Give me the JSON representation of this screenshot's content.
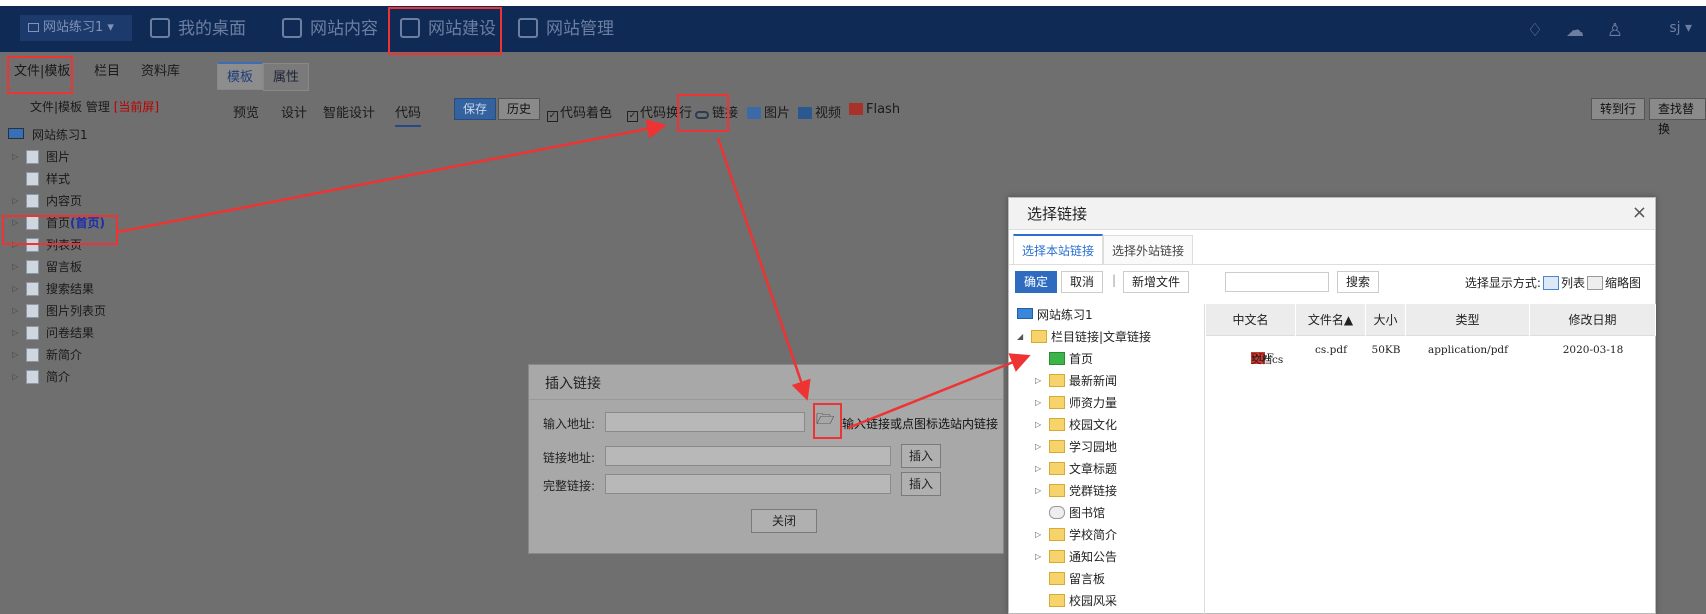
{
  "topbar": {
    "site_selector": "网站练习1",
    "nav": [
      {
        "label": "我的桌面",
        "icon": "grid-icon"
      },
      {
        "label": "网站内容",
        "icon": "edit-icon"
      },
      {
        "label": "网站建设",
        "icon": "build-icon"
      },
      {
        "label": "网站管理",
        "icon": "manage-icon"
      }
    ],
    "user": "sj ▾",
    "right_icons": [
      "bell-icon",
      "cloud-icon",
      "shirt-icon"
    ]
  },
  "left": {
    "tabs": [
      "文件|模板",
      "栏目",
      "资料库"
    ],
    "subtitle": "文件|模板 管理",
    "subtitle_tag": "[当前屏]",
    "tree_root": "网站练习1",
    "tree": [
      {
        "label": "图片",
        "selected": false
      },
      {
        "label": "样式",
        "selected": false
      },
      {
        "label": "内容页",
        "selected": false
      },
      {
        "label": "首页",
        "extra": "(首页)",
        "selected": true
      },
      {
        "label": "列表页",
        "selected": false
      },
      {
        "label": "留言板",
        "selected": false
      },
      {
        "label": "搜索结果",
        "selected": false
      },
      {
        "label": "图片列表页",
        "selected": false
      },
      {
        "label": "问卷结果",
        "selected": false
      },
      {
        "label": "新简介",
        "selected": false
      },
      {
        "label": "简介",
        "selected": false
      }
    ]
  },
  "editor": {
    "tabs": [
      "模板",
      "属性"
    ],
    "modes": [
      "预览",
      "设计",
      "智能设计",
      "代码"
    ],
    "save": "保存",
    "history": "历史",
    "opt_color": "代码着色",
    "opt_wrap": "代码换行",
    "link": "链接",
    "image": "图片",
    "video": "视频",
    "flash": "Flash",
    "goto_line": "转到行",
    "find_replace": "查找替换"
  },
  "insert_link": {
    "title": "插入链接",
    "input_label": "输入地址:",
    "hint": "输入链接或点图标选站内链接",
    "link_label": "链接地址:",
    "full_label": "完整链接:",
    "insert": "插入",
    "close": "关闭"
  },
  "select_link": {
    "title": "选择链接",
    "close": "×",
    "tabs": [
      "选择本站链接",
      "选择外站链接"
    ],
    "confirm": "确定",
    "cancel": "取消",
    "new_file": "新增文件",
    "search": "搜索",
    "display_mode": "选择显示方式:",
    "mode_list": "列表",
    "mode_thumb": "缩略图",
    "tree_root": "网站练习1",
    "tree_group": "栏目链接|文章链接",
    "tree": [
      "首页",
      "最新新闻",
      "师资力量",
      "校园文化",
      "学习园地",
      "文章标题",
      "党群链接",
      "图书馆",
      "学校简介",
      "通知公告",
      "留言板",
      "校园风采"
    ],
    "columns": [
      "中文名",
      "文件名▲",
      "大小",
      "类型",
      "修改日期"
    ],
    "rows": [
      {
        "name": "文档cs",
        "file": "cs.pdf",
        "size": "50KB",
        "type": "application/pdf",
        "date": "2020-03-18"
      }
    ]
  },
  "colors": {
    "annotation": "#ee3333",
    "topbar": "#0f2a55",
    "accent": "#2f6cc0"
  }
}
